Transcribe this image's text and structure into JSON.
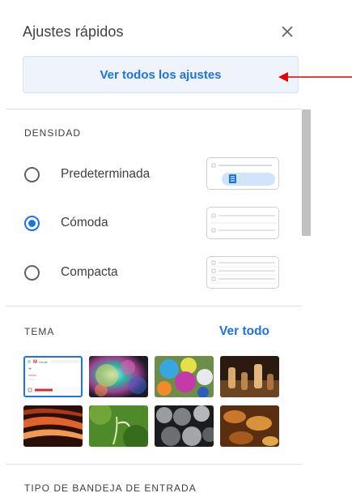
{
  "header": {
    "title": "Ajustes rápidos",
    "close_icon": "close-icon"
  },
  "all_settings_button": {
    "label": "Ver todos los ajustes"
  },
  "density": {
    "title": "DENSIDAD",
    "options": [
      {
        "label": "Predeterminada",
        "selected": false
      },
      {
        "label": "Cómoda",
        "selected": true
      },
      {
        "label": "Compacta",
        "selected": false
      }
    ]
  },
  "theme": {
    "title": "TEMA",
    "view_all": "Ver todo",
    "thumb_logo": "Gmail"
  },
  "inbox_type": {
    "title": "TIPO DE BANDEJA DE ENTRADA"
  },
  "colors": {
    "accent": "#1a73e8",
    "annotation_arrow": "#e60000"
  }
}
